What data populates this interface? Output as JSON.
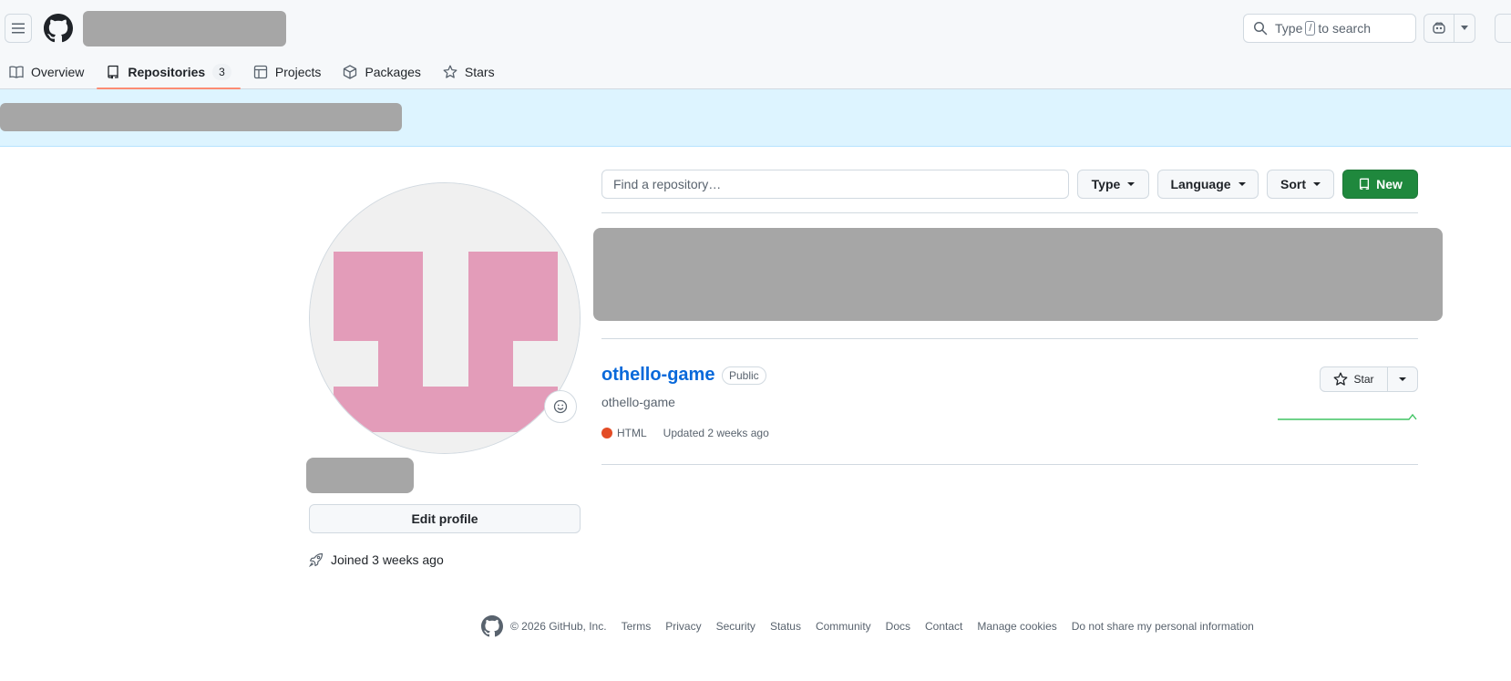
{
  "header": {
    "search_prefix": "Type",
    "search_key": "/",
    "search_suffix": "to search"
  },
  "tabs": [
    {
      "label": "Overview"
    },
    {
      "label": "Repositories",
      "count": "3"
    },
    {
      "label": "Projects"
    },
    {
      "label": "Packages"
    },
    {
      "label": "Stars"
    }
  ],
  "sidebar": {
    "edit_profile": "Edit profile",
    "joined": "Joined 3 weeks ago",
    "avatar_color": "#e39cb9"
  },
  "repo_toolbar": {
    "find_placeholder": "Find a repository…",
    "type_label": "Type",
    "language_label": "Language",
    "sort_label": "Sort",
    "new_label": "New"
  },
  "repos": [
    {
      "name": "othello-game",
      "visibility": "Public",
      "description": "othello-game",
      "language": "HTML",
      "language_color": "#e34c26",
      "updated": "Updated 2 weeks ago",
      "star_label": "Star"
    }
  ],
  "footer": {
    "copyright": "© 2026 GitHub, Inc.",
    "links": [
      "Terms",
      "Privacy",
      "Security",
      "Status",
      "Community",
      "Docs",
      "Contact",
      "Manage cookies",
      "Do not share my personal information"
    ]
  },
  "colors": {
    "accent_green": "#1f883d",
    "link_blue": "#0969da",
    "banner_bg": "#ddf4ff"
  }
}
